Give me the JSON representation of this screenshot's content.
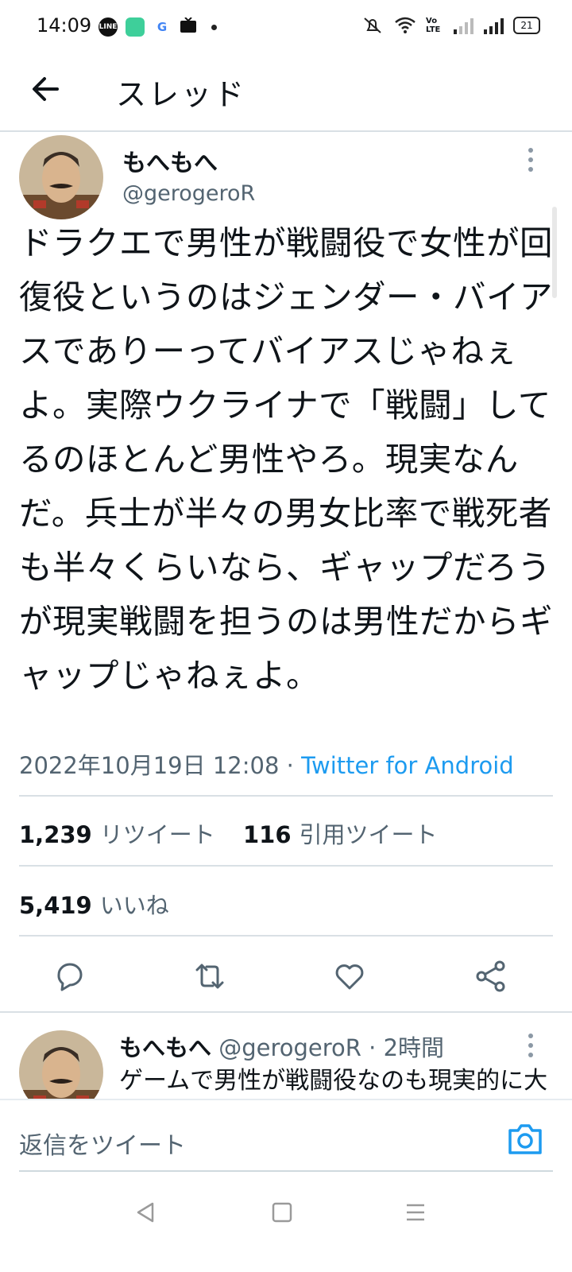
{
  "status_bar": {
    "time": "14:09",
    "apps": [
      "LINE",
      "",
      "G",
      ""
    ],
    "battery": "21",
    "network": "Vo LTE"
  },
  "header": {
    "title": "スレッド"
  },
  "tweet": {
    "name": "もへもへ",
    "handle": "@gerogeroR",
    "text": "ドラクエで男性が戦闘役で女性が回復役というのはジェンダー・バイアスでありーってバイアスじゃねぇよ。実際ウクライナで「戦闘」してるのほとんど男性やろ。現実なんだ。兵士が半々の男女比率で戦死者も半々くらいなら、ギャップだろうが現実戦闘を担うのは男性だからギャップじゃねぇよ。",
    "timestamp": "2022年10月19日 12:08",
    "separator": "·",
    "source": "Twitter for Android",
    "retweets_count": "1,239",
    "retweets_label": "リツイート",
    "quotes_count": "116",
    "quotes_label": "引用ツイート",
    "likes_count": "5,419",
    "likes_label": "いいね"
  },
  "reply": {
    "name": "もへもへ",
    "handle": "@gerogeroR",
    "separator": "·",
    "time": "2時間",
    "text": "ゲームで男性が戦闘役なのも現実的に大きな戦闘を女性が担うことがない自然なことだ"
  },
  "compose": {
    "placeholder": "返信をツイート"
  },
  "colors": {
    "accent": "#1d9bf0",
    "muted": "#536471",
    "text": "#0f1419",
    "divider": "#d9e0e5"
  }
}
